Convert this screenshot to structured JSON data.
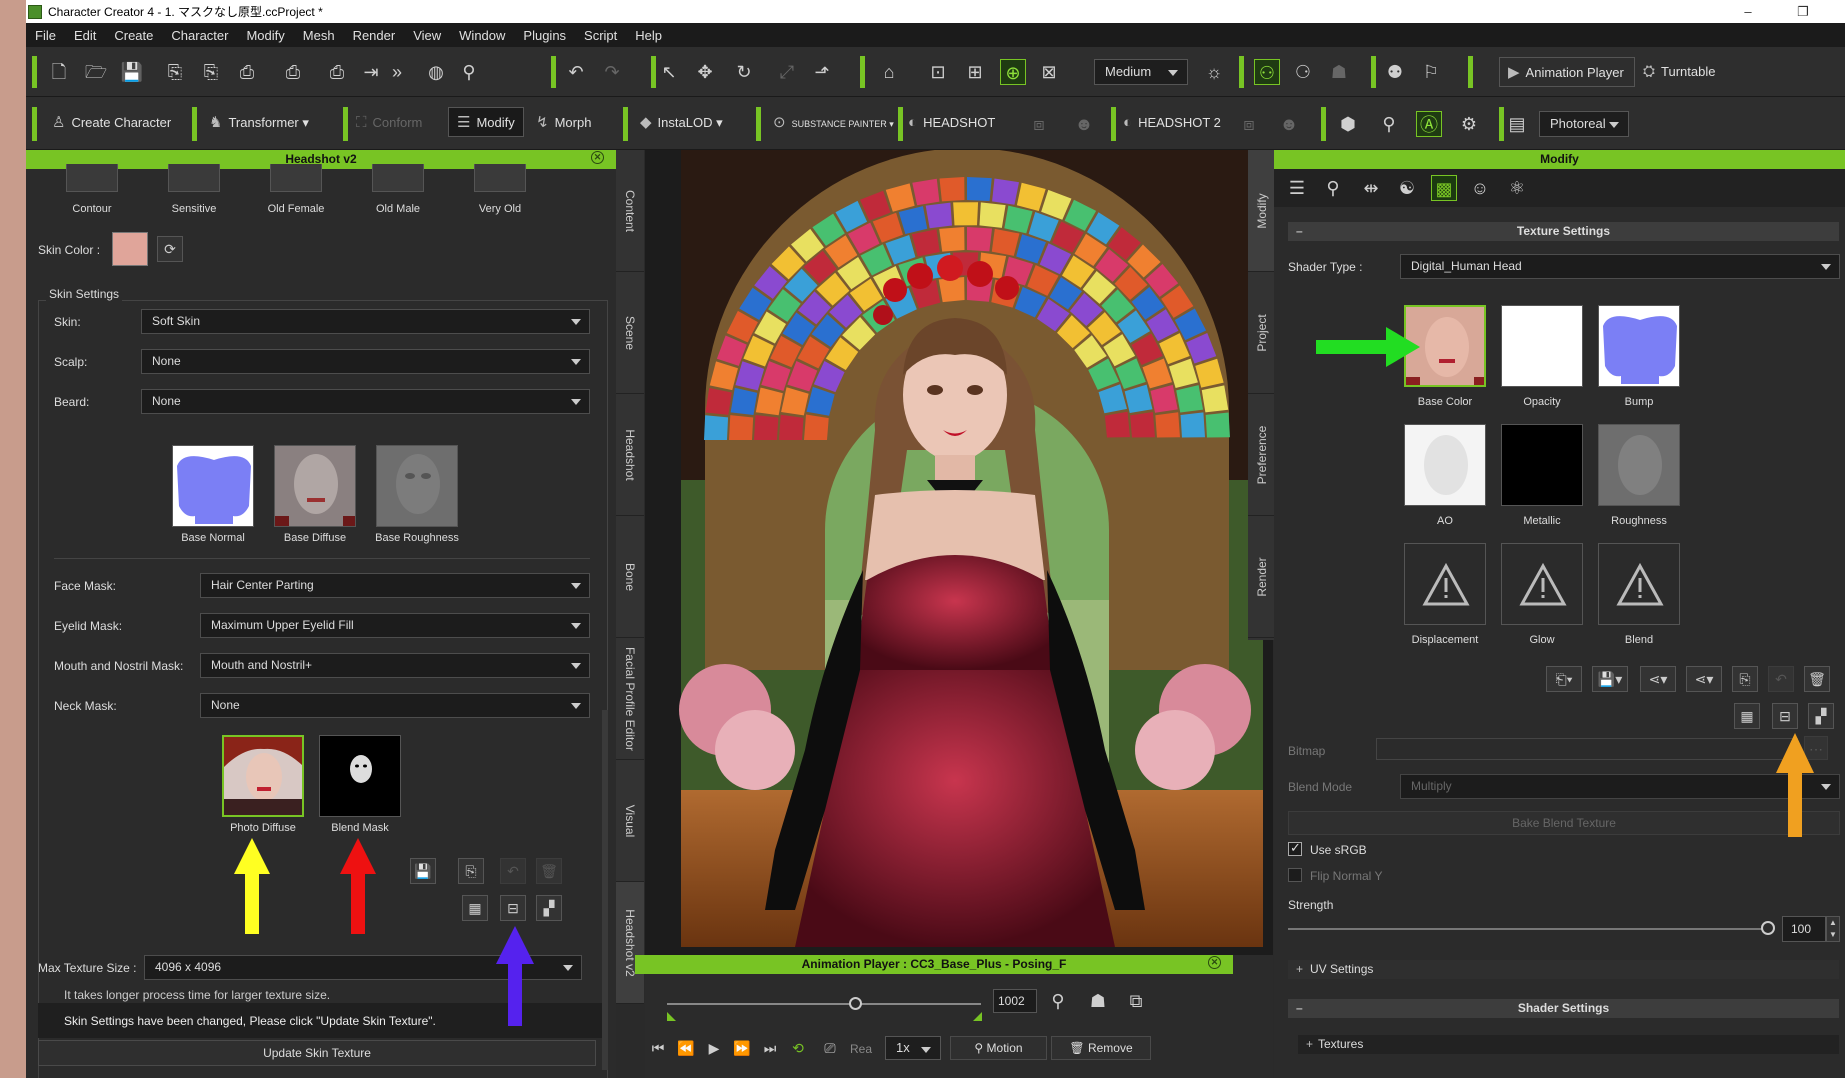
{
  "window": {
    "title": "Character Creator 4 - 1. マスクなし原型.ccProject *",
    "minimize": "–",
    "restore": "❐"
  },
  "menu": [
    "File",
    "Edit",
    "Create",
    "Character",
    "Modify",
    "Mesh",
    "Render",
    "View",
    "Window",
    "Plugins",
    "Script",
    "Help"
  ],
  "toolbar1": {
    "quality": "Medium",
    "animation_player": "Animation Player",
    "turntable": "Turntable"
  },
  "toolbar2": {
    "create_character": "Create Character",
    "transformer": "Transformer",
    "conform": "Conform",
    "modify": "Modify",
    "morph": "Morph",
    "instalod": "InstaLOD",
    "substance": "SUBSTANCE PAINTER",
    "headshot": "HEADSHOT",
    "headshot2": "HEADSHOT 2",
    "render_mode": "Photoreal"
  },
  "left_panel": {
    "title": "Headshot v2",
    "presets": [
      "Contour",
      "Sensitive",
      "Old Female",
      "Old Male",
      "Very Old"
    ],
    "skin_color_label": "Skin Color :",
    "skin_color": "#e0a59a",
    "skin_settings_title": "Skin Settings",
    "skin": {
      "label": "Skin:",
      "value": "Soft Skin"
    },
    "scalp": {
      "label": "Scalp:",
      "value": "None"
    },
    "beard": {
      "label": "Beard:",
      "value": "None"
    },
    "base_maps": [
      "Base Normal",
      "Base Diffuse",
      "Base Roughness"
    ],
    "face_mask": {
      "label": "Face Mask:",
      "value": "Hair Center Parting"
    },
    "eyelid_mask": {
      "label": "Eyelid Mask:",
      "value": "Maximum Upper Eyelid Fill"
    },
    "mouth_mask": {
      "label": "Mouth and Nostril Mask:",
      "value": "Mouth and Nostril+"
    },
    "neck_mask": {
      "label": "Neck Mask:",
      "value": "None"
    },
    "mask_maps": [
      "Photo Diffuse",
      "Blend Mask"
    ],
    "max_texture": {
      "label": "Max Texture Size :",
      "value": "4096 x 4096"
    },
    "hint": "It takes longer process time for larger texture size.",
    "notice": "Skin Settings have been changed, Please click \"Update Skin Texture\".",
    "update_button": "Update Skin Texture"
  },
  "side_tabs_left": [
    "Content",
    "Scene",
    "Headshot",
    "Bone",
    "Facial Profile Editor",
    "Visual",
    "Headshot v2"
  ],
  "side_tabs_right": [
    "Modify",
    "Project",
    "Preference",
    "Render"
  ],
  "animation_player": {
    "title": "Animation Player : CC3_Base_Plus - Posing_F",
    "frame": "1002",
    "progress": 0.6,
    "realtime": "Rea",
    "speed": "1x",
    "motion": "Motion",
    "remove": "Remove"
  },
  "right_panel": {
    "title": "Modify",
    "texture_settings": "Texture Settings",
    "shader_type_label": "Shader Type :",
    "shader_type": "Digital_Human Head",
    "textures": [
      "Base Color",
      "Opacity",
      "Bump",
      "AO",
      "Metallic",
      "Roughness",
      "Displacement",
      "Glow",
      "Blend"
    ],
    "bitmap_label": "Bitmap",
    "blend_mode_label": "Blend Mode",
    "blend_mode": "Multiply",
    "bake_button": "Bake Blend Texture",
    "use_srgb": "Use sRGB",
    "flip_normal": "Flip Normal Y",
    "strength_label": "Strength",
    "strength": "100",
    "strength_fraction": 1.0,
    "uv_settings": "UV Settings",
    "shader_settings": "Shader Settings",
    "textures_section": "Textures"
  },
  "colors": {
    "accent": "#78c424",
    "arrow_green": "#22dd22",
    "arrow_yellow": "#ffff22",
    "arrow_red": "#ee1111",
    "arrow_blue": "#5522ee",
    "arrow_orange": "#f0a020"
  }
}
